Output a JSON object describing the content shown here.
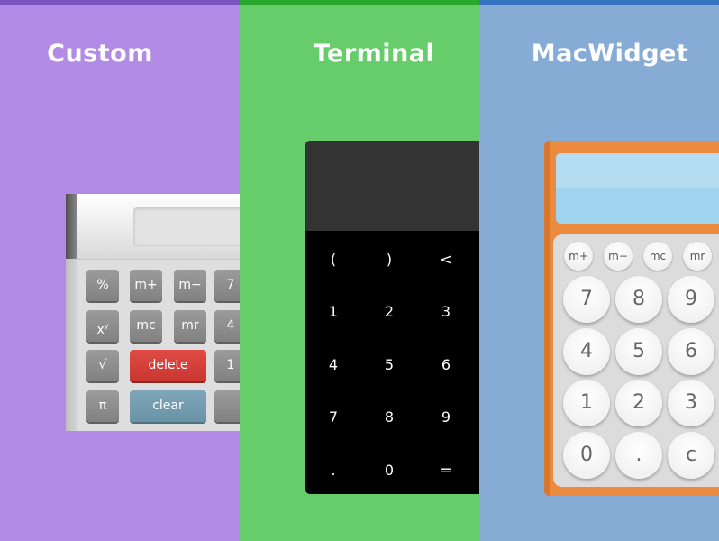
{
  "panels": {
    "custom": {
      "title": "Custom",
      "keys": {
        "percent": "%",
        "m_plus": "m+",
        "m_minus": "m−",
        "seven": "7",
        "power_base": "x",
        "power_exp": "y",
        "mc": "mc",
        "mr": "mr",
        "four": "4",
        "sqrt": "√",
        "delete": "delete",
        "one": "1",
        "pi": "π",
        "clear": "clear"
      },
      "colors": {
        "background": "#b18be6",
        "accent_bar": "#7d55c1",
        "delete_key": "#d9403a",
        "clear_key": "#7499ab"
      }
    },
    "terminal": {
      "title": "Terminal",
      "keys": {
        "lparen": "(",
        "rparen": ")",
        "backspace": "<",
        "one": "1",
        "two": "2",
        "three": "3",
        "four": "4",
        "five": "5",
        "six": "6",
        "seven": "7",
        "eight": "8",
        "nine": "9",
        "dot": ".",
        "zero": "0",
        "equals": "="
      },
      "colors": {
        "background": "#66cd6a",
        "accent_bar": "#27a82a",
        "display": "#333333",
        "body": "#000000"
      }
    },
    "macwidget": {
      "title": "MacWidget",
      "keys": {
        "m_plus": "m+",
        "m_minus": "m−",
        "mc": "mc",
        "mr": "mr",
        "seven": "7",
        "eight": "8",
        "nine": "9",
        "four": "4",
        "five": "5",
        "six": "6",
        "one": "1",
        "two": "2",
        "three": "3",
        "zero": "0",
        "dot": ".",
        "clear": "c"
      },
      "colors": {
        "background": "#86acd6",
        "accent_bar": "#3575c0",
        "body": "#ec8b3f",
        "display": "#9fd3ee"
      }
    }
  }
}
